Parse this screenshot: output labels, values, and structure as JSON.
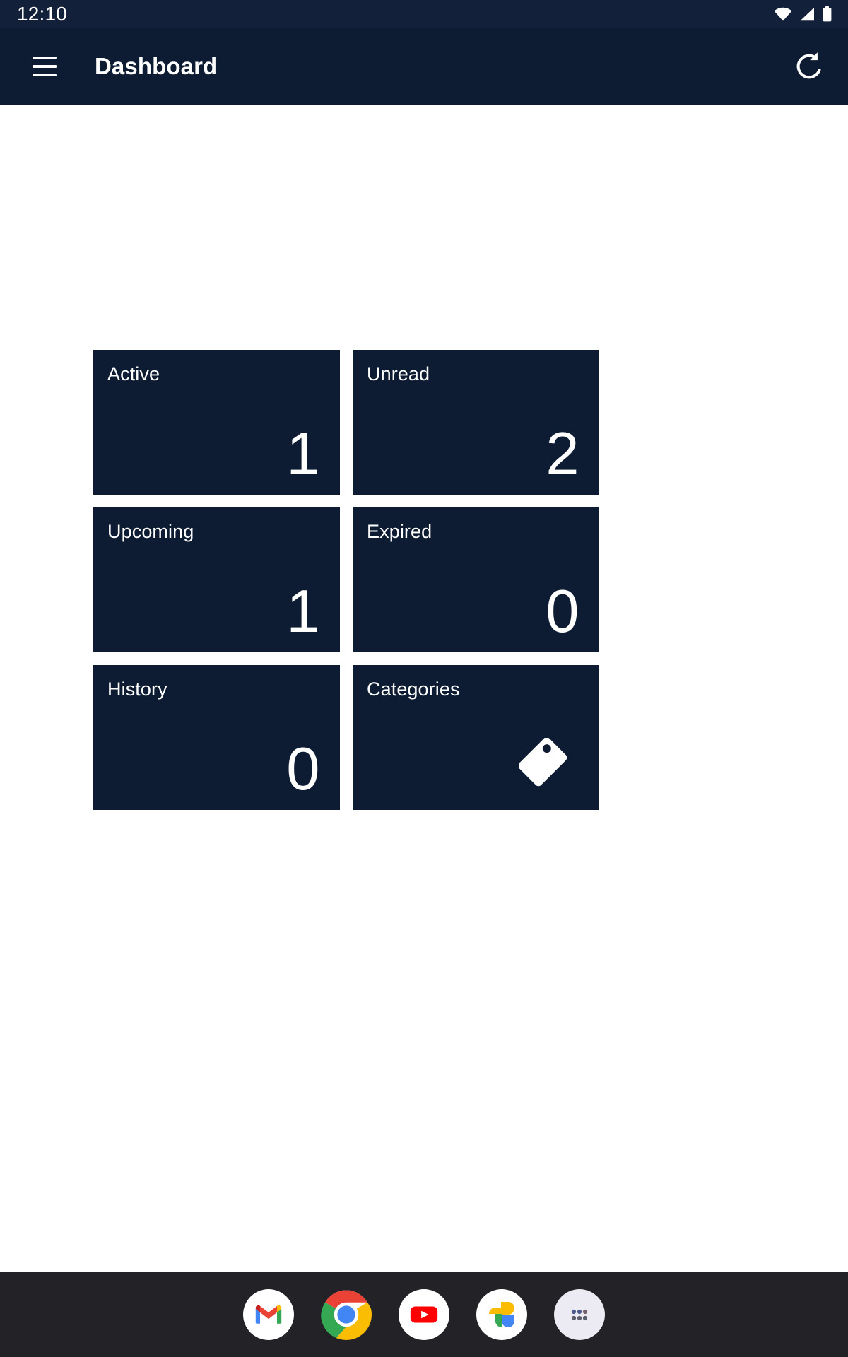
{
  "status_bar": {
    "clock": "12:10",
    "icons": [
      "wifi-icon",
      "cellular-signal-icon",
      "battery-full-icon"
    ]
  },
  "app_bar": {
    "menu_icon": "hamburger-menu-icon",
    "title": "Dashboard",
    "refresh_icon": "refresh-icon"
  },
  "dashboard": {
    "tiles": [
      {
        "label": "Active",
        "value": "1",
        "icon": null
      },
      {
        "label": "Unread",
        "value": "2",
        "icon": null
      },
      {
        "label": "Upcoming",
        "value": "1",
        "icon": null
      },
      {
        "label": "Expired",
        "value": "0",
        "icon": null
      },
      {
        "label": "History",
        "value": "0",
        "icon": null
      },
      {
        "label": "Categories",
        "value": "",
        "icon": "tag-icon"
      }
    ]
  },
  "dock": {
    "apps": [
      {
        "name": "Gmail",
        "icon": "gmail-icon"
      },
      {
        "name": "Chrome",
        "icon": "chrome-icon"
      },
      {
        "name": "YouTube",
        "icon": "youtube-icon"
      },
      {
        "name": "Google Photos",
        "icon": "google-photos-icon"
      },
      {
        "name": "App Drawer",
        "icon": "app-drawer-icon"
      }
    ]
  },
  "colors": {
    "status_bar_bg": "#13203a",
    "app_bar_bg": "#0e1c33",
    "tile_bg": "#0e1c33",
    "page_bg": "#ffffff",
    "dock_bg": "#222227",
    "on_dark_text": "#ffffff"
  }
}
